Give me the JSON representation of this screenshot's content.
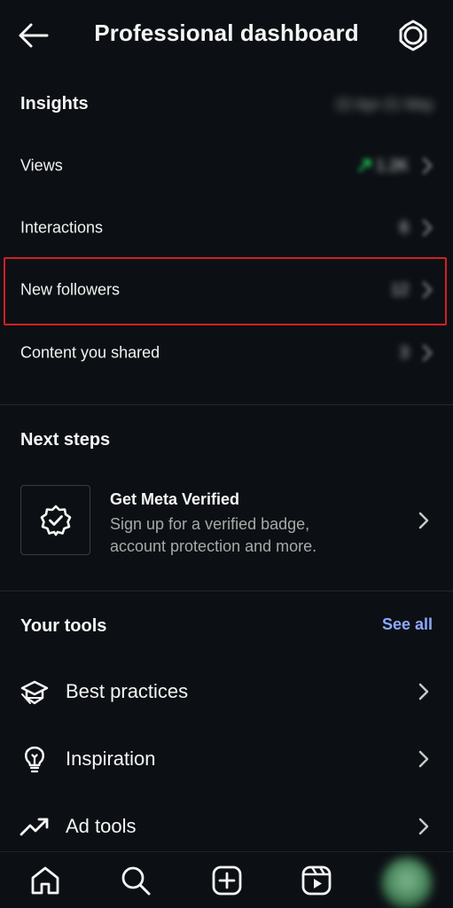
{
  "header": {
    "title": "Professional dashboard",
    "back_icon": "arrow-left-icon",
    "settings_icon": "gear-icon"
  },
  "insights": {
    "title": "Insights",
    "date_range": "22 Apr-21 May",
    "rows": [
      {
        "label": "Views",
        "value": "1.2K"
      },
      {
        "label": "Interactions",
        "value": "6"
      },
      {
        "label": "New followers",
        "value": "12"
      },
      {
        "label": "Content you shared",
        "value": "3"
      }
    ]
  },
  "next_steps": {
    "title": "Next steps",
    "card_title": "Get Meta Verified",
    "card_description": "Sign up for a verified badge, account protection and more."
  },
  "tools": {
    "title": "Your tools",
    "see_all": "See all",
    "items": [
      {
        "label": "Best practices",
        "icon": "graduation-cap-icon"
      },
      {
        "label": "Inspiration",
        "icon": "lightbulb-icon"
      },
      {
        "label": "Ad tools",
        "icon": "trend-arrow-icon"
      }
    ]
  },
  "bottom_nav": {
    "items": [
      "home-icon",
      "search-icon",
      "create-icon",
      "reels-icon",
      "profile-avatar"
    ]
  },
  "colors": {
    "background": "#0c1014",
    "accent_link": "#8da8ff",
    "highlight_border": "#d21f25",
    "trend_green": "#1db954"
  }
}
